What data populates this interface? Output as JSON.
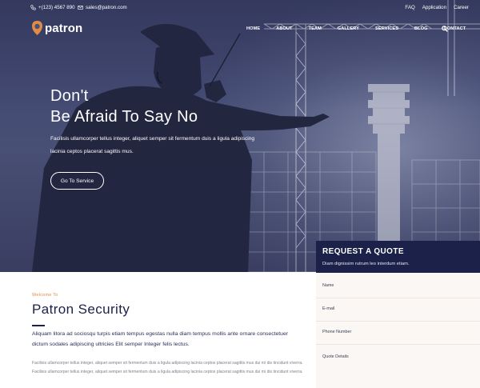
{
  "topbar": {
    "phone": "+(123) 4567 890",
    "email": "sales@patron.com",
    "links": [
      "FAQ",
      "Application",
      "Career"
    ]
  },
  "brand": {
    "name": "patron",
    "accent": "#e28b46"
  },
  "nav": {
    "items": [
      "HOME",
      "ABOUT",
      "TEAM",
      "GALLERY",
      "SERVICES",
      "BLOG",
      "CONTACT"
    ],
    "search_icon": "search-icon"
  },
  "hero": {
    "headline_line1": "Don't",
    "headline_line2": "Be Afraid To Say No",
    "lead": "Facilisis ullamcorper tellus integer, aliquet semper sit fermentum duis a ligula adipiscing lacinia ceptos placerat sagittis mus.",
    "cta_label": "Go To Service"
  },
  "quote": {
    "title": "REQUEST A QUOTE",
    "subtitle": "Diam dignissim rutrum leo interdum etiam.",
    "fields": [
      "Name",
      "E-mail",
      "Phone Number",
      "Quote Details"
    ],
    "header_color": "#1b2148"
  },
  "about": {
    "welcome": "Welcome To",
    "title": "Patron Security",
    "lead": "Aliquam litora ad sociosqu turpis etiam tempus egestas nulla diam tempus mollis ante ornare consectetuer dictum sodales adipiscing ultricies Elit semper Integer felis lectus.",
    "body": "Facilisis ullamcorper tellus integer, aliquet semper sit fermentum duis a ligula adipiscing lacinia ceptos placerat sagittis mus dui mi dis tincidunt viverra. Facilisis ullamcorper tellus integer, aliquet semper sit fermentum duis a ligula adipiscing lacinia ceptos placerat sagittis mus dui mi dis tincidunt viverra."
  }
}
